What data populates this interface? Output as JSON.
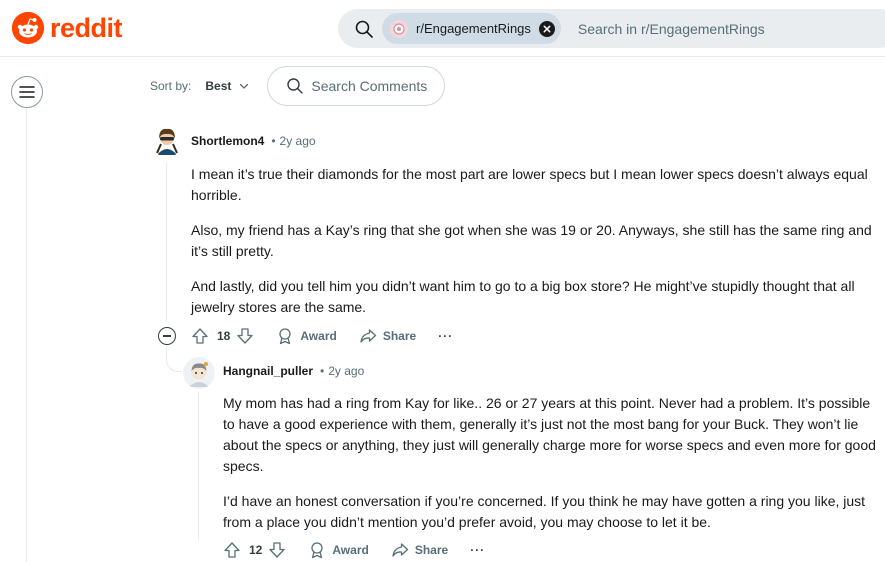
{
  "header": {
    "logo_text": "reddit",
    "search": {
      "subreddit_chip": "r/EngagementRings",
      "placeholder": "Search in r/EngagementRings"
    }
  },
  "sort": {
    "label": "Sort by:",
    "value": "Best",
    "search_comments_placeholder": "Search Comments"
  },
  "comments": [
    {
      "author": "Shortlemon4",
      "age": "2y ago",
      "paragraphs": [
        "I mean it’s true their diamonds for the most part are lower specs but I mean lower specs doesn’t always equal horrible.",
        "Also, my friend has a Kay’s ring that she got when she was 19 or 20. Anyways, she still has the same ring and it’s still pretty.",
        "And lastly, did you tell him you didn’t want him to go to a big box store? He might’ve stupidly thought that all jewelry stores are the same."
      ],
      "score": "18",
      "award_label": "Award",
      "share_label": "Share",
      "more_label": "···"
    },
    {
      "author": "Hangnail_puller",
      "age": "2y ago",
      "paragraphs": [
        "My mom has had a ring from Kay for like.. 26 or 27 years at this point. Never had a problem. It’s possible to have a good experience with them, generally it’s just not the most bang for your Buck. They won’t lie about the specs or anything, they just will generally charge more for worse specs and even more for good specs.",
        "I’d have an honest conversation if you’re concerned. If you think he may have gotten a ring you like, just from a place you didn’t mention you’d prefer avoid, you may choose to let it be."
      ],
      "score": "12",
      "award_label": "Award",
      "share_label": "Share",
      "more_label": "···"
    }
  ],
  "colors": {
    "brand": "#ff4500",
    "muted_text": "#576f76",
    "divider": "#e5ebee"
  }
}
